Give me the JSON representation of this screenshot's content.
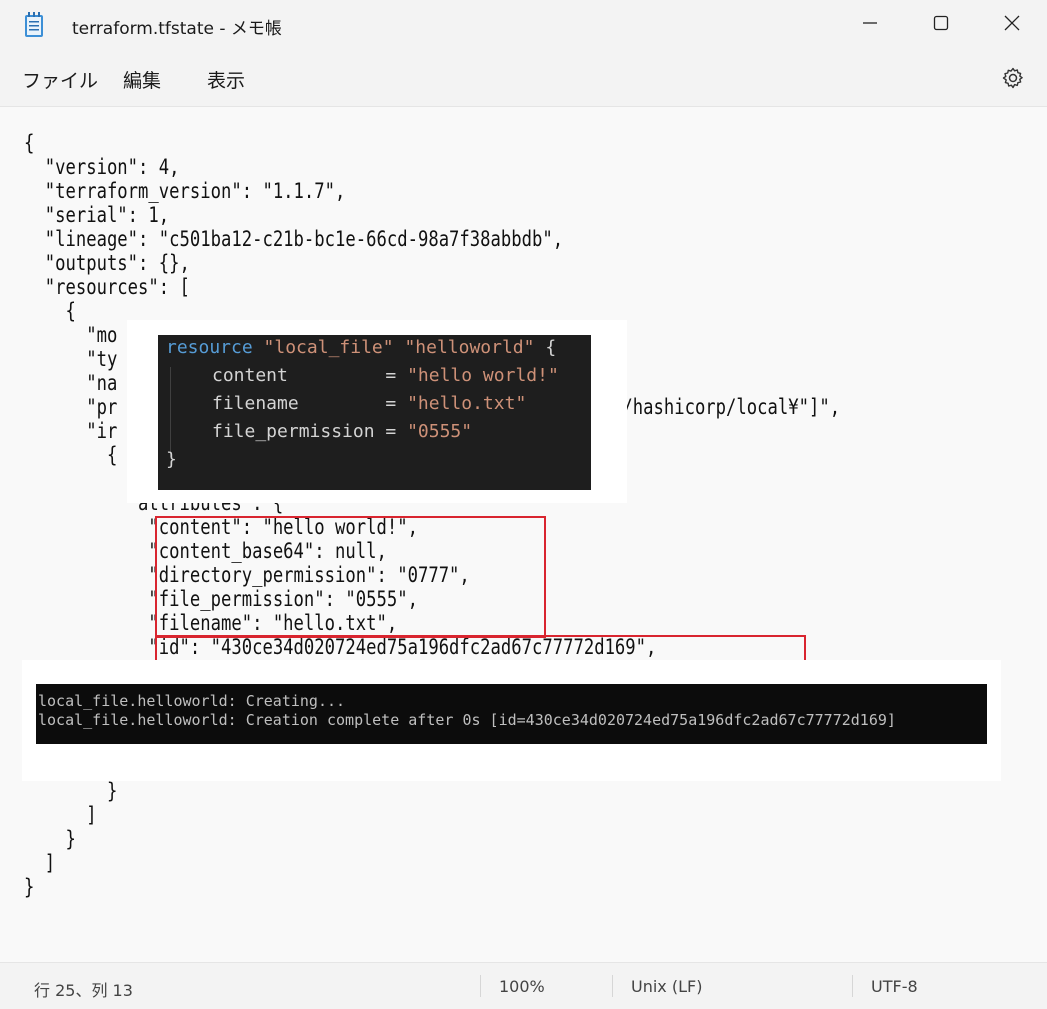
{
  "window": {
    "title": "terraform.tfstate - メモ帳"
  },
  "menu": {
    "file": "ファイル",
    "edit": "編集",
    "view": "表示"
  },
  "editor": {
    "lines": [
      "{",
      "  \"version\": 4,",
      "  \"terraform_version\": \"1.1.7\",",
      "  \"serial\": 1,",
      "  \"lineage\": \"c501ba12-c21b-bc1e-66cd-98a7f38abbdb\",",
      "  \"outputs\": {},",
      "  \"resources\": [",
      "    {",
      "      \"mo",
      "      \"ty",
      "      \"na",
      "      \"pr",
      "      \"ir",
      "        {",
      "          \"attributes\": {",
      "            \"content\": \"hello world!\",",
      "            \"content_base64\": null,",
      "            \"directory_permission\": \"0777\",",
      "            \"file_permission\": \"0555\",",
      "            \"filename\": \"hello.txt\",",
      "            \"id\": \"430ce34d020724ed75a196dfc2ad67c77772d169\",",
      "        }",
      "      ]",
      "    }",
      "  ]",
      "}"
    ],
    "provider_tail": "o/hashicorp/local¥\"]\","
  },
  "code_snippet": {
    "line1": {
      "kw": "resource",
      "type": "\"local_file\"",
      "name": "\"helloworld\"",
      "brace": " {"
    },
    "line2": {
      "key": "content         = ",
      "val": "\"hello world!\""
    },
    "line3": {
      "key": "filename        = ",
      "val": "\"hello.txt\""
    },
    "line4": {
      "key": "file_permission = ",
      "val": "\"0555\""
    },
    "line5": "}"
  },
  "terminal": {
    "line1": "local_file.helloworld: Creating...",
    "line2": "local_file.helloworld: Creation complete after 0s [id=430ce34d020724ed75a196dfc2ad67c77772d169]"
  },
  "status": {
    "position": "行 25、列 13",
    "zoom": "100%",
    "line_ending": "Unix (LF)",
    "encoding": "UTF-8"
  }
}
